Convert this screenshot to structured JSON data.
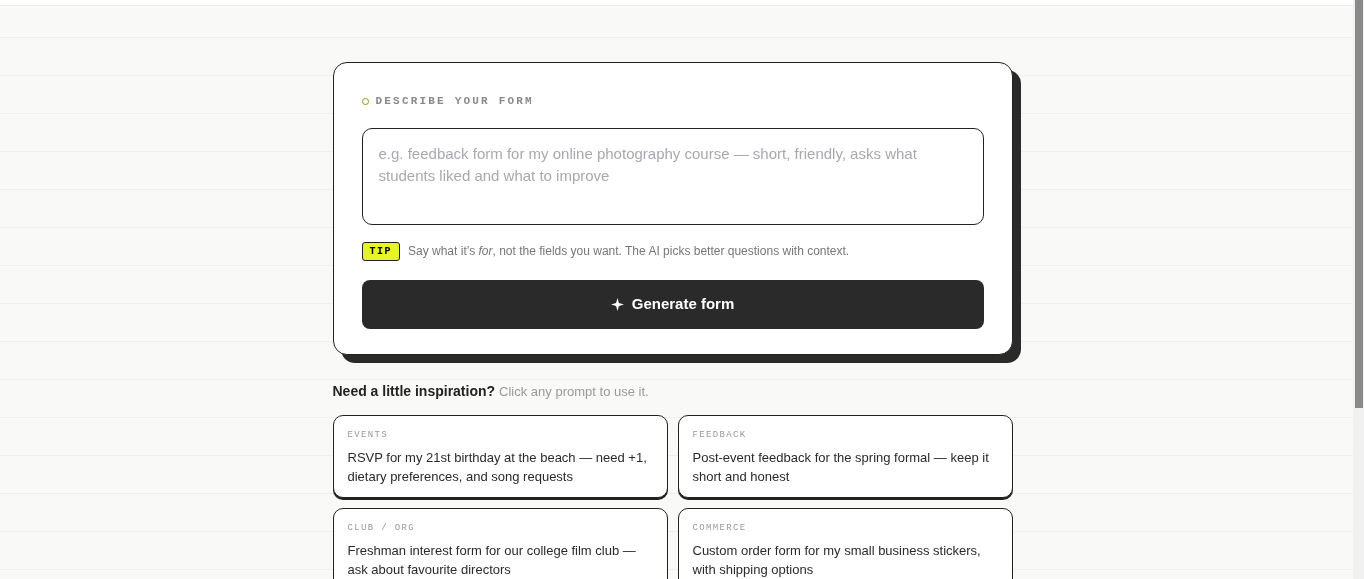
{
  "composer": {
    "label": "DESCRIBE YOUR FORM",
    "placeholder": "e.g. feedback form for my online photography course — short, friendly, asks what students liked and what to improve",
    "tip_badge": "TIP",
    "tip_text": "Say what it’s *for*, not the fields you want. The AI picks better questions with context.",
    "button": "Generate form"
  },
  "inspiration": {
    "heading": "Need a little inspiration?",
    "hint": "Click any prompt to use it.",
    "prompts": [
      {
        "category": "EVENTS",
        "text": "RSVP for my 21st birthday at the beach — need +1, dietary preferences, and song requests"
      },
      {
        "category": "FEEDBACK",
        "text": "Post-event feedback for the spring formal — keep it short and honest"
      },
      {
        "category": "CLUB / ORG",
        "text": "Freshman interest form for our college film club — ask about favourite directors"
      },
      {
        "category": "COMMERCE",
        "text": "Custom order form for my small business stickers, with shipping options"
      }
    ]
  }
}
